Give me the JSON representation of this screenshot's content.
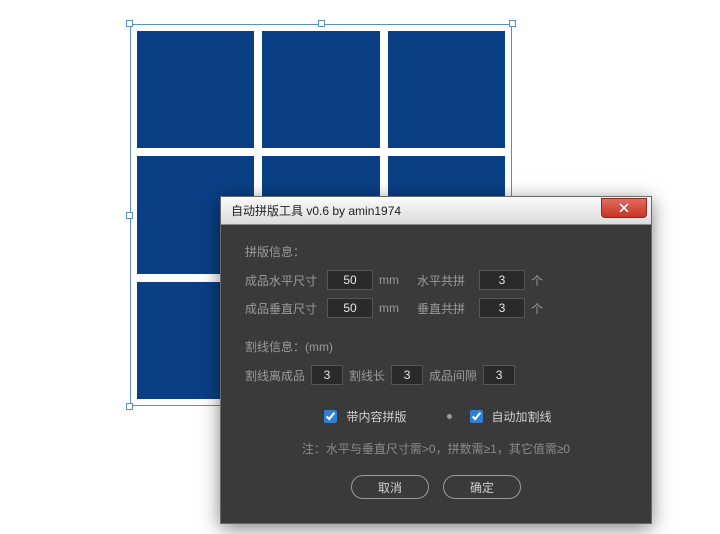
{
  "artboard": {
    "rows": 3,
    "cols": 3
  },
  "dialog": {
    "title": "自动拼版工具 v0.6   by amin1974",
    "section1_title": "拼版信息：",
    "hsize_label": "成品水平尺寸",
    "hsize_value": "50",
    "hsize_unit": "mm",
    "hcount_label": "水平共拼",
    "hcount_value": "3",
    "hcount_unit": "个",
    "vsize_label": "成品垂直尺寸",
    "vsize_value": "50",
    "vsize_unit": "mm",
    "vcount_label": "垂直共拼",
    "vcount_value": "3",
    "vcount_unit": "个",
    "section2_title": "割线信息：(mm)",
    "cut_dist_label": "割线离成品",
    "cut_dist_value": "3",
    "cut_len_label": "割线长",
    "cut_len_value": "3",
    "gap_label": "成品间隙",
    "gap_value": "3",
    "chk1_label": "带内容拼版",
    "chk1_checked": true,
    "chk2_label": "自动加割线",
    "chk2_checked": true,
    "note": "注：水平与垂直尺寸需>0，拼数需≥1，其它值需≥0",
    "cancel": "取消",
    "ok": "确定"
  }
}
